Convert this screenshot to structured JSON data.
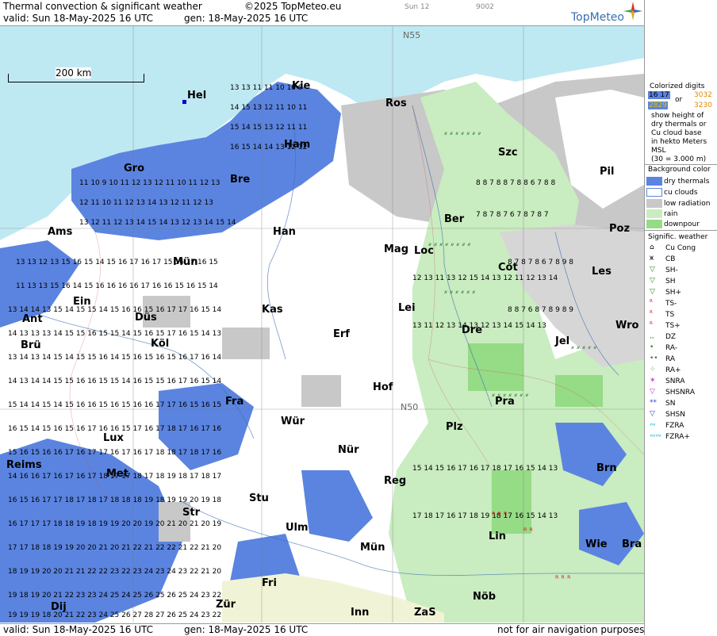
{
  "header": {
    "title": "Thermal convection & significant weather",
    "copyright": "©2025 TopMeteo.eu",
    "sun": "Sun 12",
    "code": "9002",
    "valid": "valid:  Sun  18-May-2025  16 UTC",
    "gen": "gen: 18-May-2025 16 UTC",
    "logo": "TopMeteo"
  },
  "footer": {
    "valid": "valid:  Sun  18-May-2025  16 UTC",
    "gen": "gen: 18-May-2025 16 UTC",
    "note": "not for air navigation purposes"
  },
  "map": {
    "scale_label": "200 km",
    "lat_labels": [
      "N55",
      "N50"
    ],
    "cities": [
      "Hel",
      "Kie",
      "Ros",
      "Gro",
      "Ham",
      "Szc",
      "Bre",
      "Pil",
      "Ber",
      "Ams",
      "Han",
      "Poz",
      "Mag",
      "Loc",
      "Mün",
      "Cot",
      "Les",
      "Ein",
      "Ant",
      "Düs",
      "Kas",
      "Lei",
      "Wro",
      "Brü",
      "Köl",
      "Erf",
      "Dre",
      "Jel",
      "Hof",
      "Fra",
      "Pra",
      "Wür",
      "Plz",
      "Lux",
      "Nür",
      "Met",
      "Reg",
      "Brn",
      "Reims",
      "Stu",
      "Str",
      "Ulm",
      "Lin",
      "Wie",
      "Bra",
      "Mün",
      "Fri",
      "Dij",
      "Zür",
      "Inn",
      "ZaS",
      "Nöb"
    ],
    "background_colors": {
      "dry_thermals": "#5b84e0",
      "cu_clouds": "#ffffff",
      "low_radiation": "#c8c8c8",
      "rain": "#c9ecc0",
      "downpour": "#96db86",
      "sea": "#bfe9f2"
    }
  },
  "legend": {
    "title1": "Colorized digits",
    "ex1a": "16 17",
    "ex1b": "or",
    "ex1c": "3032",
    "ex2a": "2829",
    "ex2b": "3230",
    "desc": [
      "show height of",
      "dry thermals or",
      "Cu cloud base",
      "in hekto Meters",
      "MSL",
      "(30 = 3.000 m)"
    ],
    "bg_title": "Background color",
    "bg_items": [
      "dry thermals",
      "cu clouds",
      "low radiation",
      "rain",
      "downpour"
    ],
    "sig_title": "Signific. weather",
    "sig_items": [
      "Cu Cong",
      "CB",
      "SH-",
      "SH",
      "SH+",
      "TS-",
      "TS",
      "TS+",
      "DZ",
      "RA-",
      "RA",
      "RA+",
      "SNRA",
      "SHSNRA",
      "SN",
      "SHSN",
      "FZRA",
      "FZRA+"
    ]
  }
}
